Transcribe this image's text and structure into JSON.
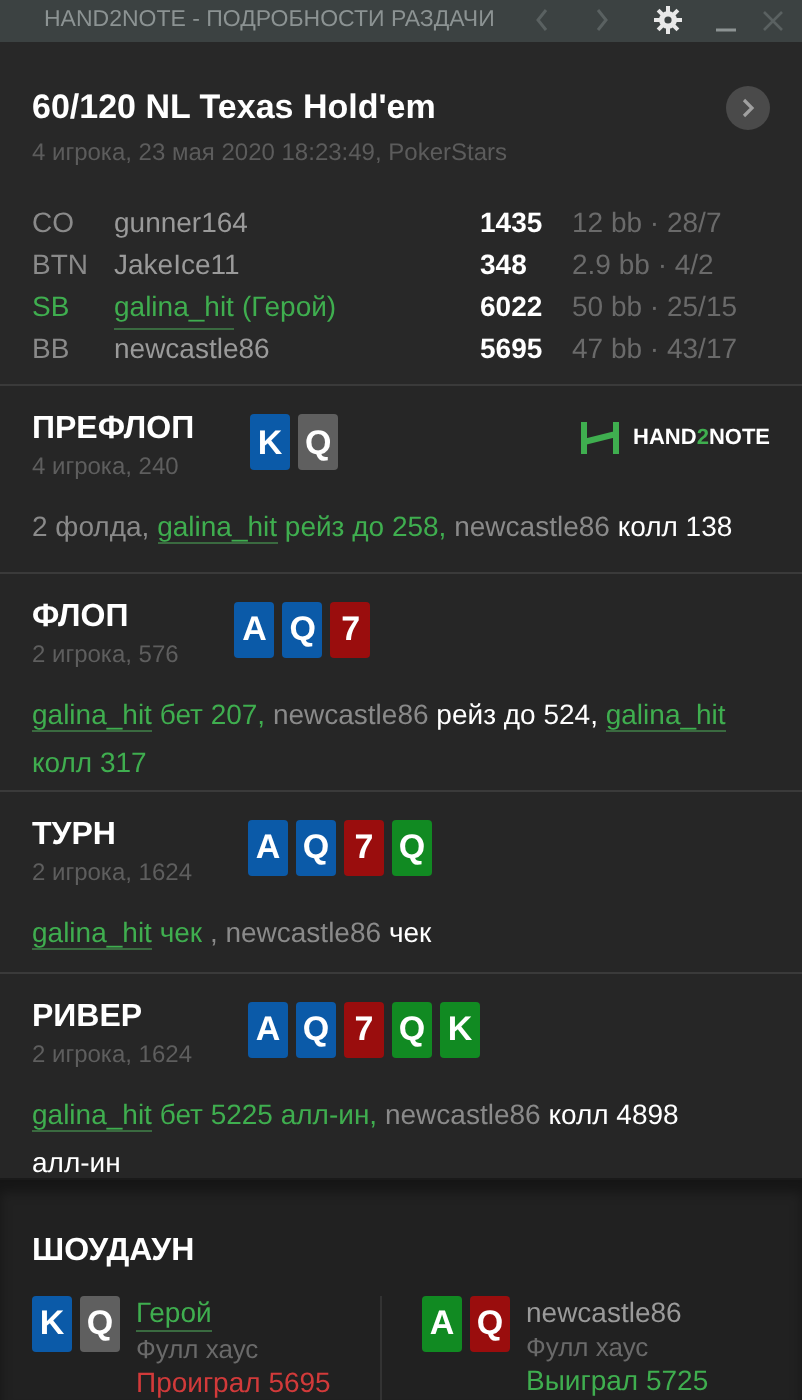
{
  "window": {
    "title": "HAND2NOTE - ПОДРОБНОСТИ РАЗДАЧИ"
  },
  "header": {
    "title": "60/120 NL Texas Hold'em",
    "subtitle": "4 игрока, 23 мая 2020 18:23:49, PokerStars"
  },
  "players": [
    {
      "position": "CO",
      "name": "gunner164",
      "hero": false,
      "stack": "1435",
      "stats": "12 bb · 28/7"
    },
    {
      "position": "BTN",
      "name": "JakeIce11",
      "hero": false,
      "stack": "348",
      "stats": "2.9 bb · 4/2"
    },
    {
      "position": "SB",
      "name": "galina_hit",
      "hero": true,
      "hero_tag": "(Герой)",
      "stack": "6022",
      "stats": "50 bb · 25/15"
    },
    {
      "position": "BB",
      "name": "newcastle86",
      "hero": false,
      "stack": "5695",
      "stats": "47 bb · 43/17"
    }
  ],
  "streets": [
    {
      "name": "ПРЕФЛОП",
      "subtitle": "4 игрока, 240",
      "logo": [
        "HAND",
        "2",
        "NOTE"
      ],
      "cards": [
        {
          "rank": "K",
          "color": "#0b5aa8"
        },
        {
          "rank": "Q",
          "color": "#5f5f5f"
        }
      ],
      "actions": [
        {
          "kind": "note",
          "text": "2 фолда,"
        },
        {
          "kind": "hero",
          "text": "galina_hit"
        },
        {
          "kind": "hero-action",
          "text": "рейз до 258,"
        },
        {
          "kind": "player",
          "text": "newcastle86"
        },
        {
          "kind": "action",
          "text": "колл 138"
        }
      ]
    },
    {
      "name": "ФЛОП",
      "subtitle": "2 игрока, 576",
      "cards": [
        {
          "rank": "A",
          "color": "#0b5aa8"
        },
        {
          "rank": "Q",
          "color": "#0b5aa8"
        },
        {
          "rank": "7",
          "color": "#9a0d0d"
        }
      ],
      "actions": [
        {
          "kind": "hero",
          "text": "galina_hit"
        },
        {
          "kind": "hero-action",
          "text": "бет 207,"
        },
        {
          "kind": "player",
          "text": "newcastle86"
        },
        {
          "kind": "action",
          "text": "рейз до 524,"
        },
        {
          "kind": "hero",
          "text": "galina_hit"
        },
        {
          "kind": "hero-action",
          "text": "колл 317"
        }
      ]
    },
    {
      "name": "ТУРН",
      "subtitle": "2 игрока, 1624",
      "cards": [
        {
          "rank": "A",
          "color": "#0b5aa8"
        },
        {
          "rank": "Q",
          "color": "#0b5aa8"
        },
        {
          "rank": "7",
          "color": "#9a0d0d"
        },
        {
          "rank": "Q",
          "color": "#118a22"
        }
      ],
      "actions": [
        {
          "kind": "hero",
          "text": "galina_hit"
        },
        {
          "kind": "hero-action",
          "text": "чек"
        },
        {
          "kind": "player",
          "text": ", newcastle86"
        },
        {
          "kind": "action",
          "text": "чек"
        }
      ]
    },
    {
      "name": "РИВЕР",
      "subtitle": "2 игрока, 1624",
      "cards": [
        {
          "rank": "A",
          "color": "#0b5aa8"
        },
        {
          "rank": "Q",
          "color": "#0b5aa8"
        },
        {
          "rank": "7",
          "color": "#9a0d0d"
        },
        {
          "rank": "Q",
          "color": "#118a22"
        },
        {
          "rank": "K",
          "color": "#118a22"
        }
      ],
      "actions": [
        {
          "kind": "hero",
          "text": "galina_hit"
        },
        {
          "kind": "hero-action",
          "text": "бет 5225 алл-ин,"
        },
        {
          "kind": "player",
          "text": "newcastle86"
        },
        {
          "kind": "action",
          "text": "колл 4898 алл-ин"
        }
      ]
    }
  ],
  "showdown": {
    "title": "ШОУДАУН",
    "players": [
      {
        "name": "Герой",
        "hero": true,
        "hand": "Фулл хаус",
        "result": "Проиграл 5695",
        "won": false,
        "cards": [
          {
            "rank": "K",
            "color": "#0b5aa8"
          },
          {
            "rank": "Q",
            "color": "#5f5f5f"
          }
        ]
      },
      {
        "name": "newcastle86",
        "hero": false,
        "hand": "Фулл хаус",
        "result": "Выиграл 5725",
        "won": true,
        "cards": [
          {
            "rank": "A",
            "color": "#118a22"
          },
          {
            "rank": "Q",
            "color": "#9a0d0d"
          }
        ]
      }
    ]
  }
}
